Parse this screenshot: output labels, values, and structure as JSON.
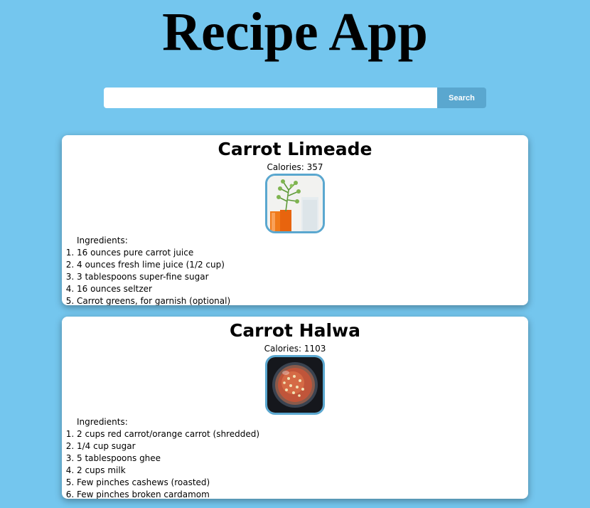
{
  "header": {
    "title": "Recipe App"
  },
  "search": {
    "placeholder": "",
    "value": "",
    "button_label": "Search"
  },
  "colors": {
    "background": "#74c6ee",
    "accent": "#5aa7cf",
    "card": "#ffffff"
  },
  "recipes": [
    {
      "title": "Carrot Limeade",
      "calories": "Calories: 357",
      "image_icon": "carrot-limeade-photo",
      "ingredients_label": "Ingredients:",
      "ingredients": [
        "16 ounces pure carrot juice",
        "4 ounces fresh lime juice (1/2 cup)",
        "3 tablespoons super-fine sugar",
        "16 ounces seltzer",
        "Carrot greens, for garnish (optional)"
      ]
    },
    {
      "title": "Carrot Halwa",
      "calories": "Calories: 1103",
      "image_icon": "carrot-halwa-photo",
      "ingredients_label": "Ingredients:",
      "ingredients": [
        "2 cups red carrot/orange carrot (shredded)",
        "1/4 cup sugar",
        "5 tablespoons ghee",
        "2 cups milk",
        "Few pinches cashews (roasted)",
        "Few pinches broken cardamom"
      ]
    }
  ]
}
